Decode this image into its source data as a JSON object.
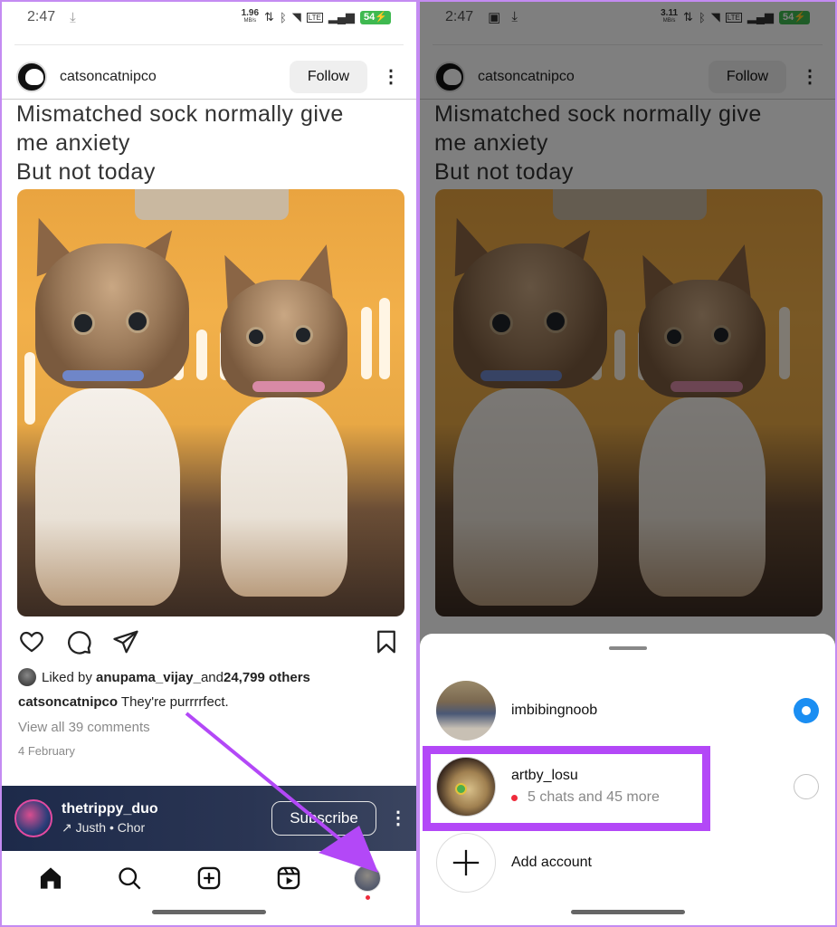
{
  "statusbar_left": {
    "time": "2:47",
    "speed_value": "1.96",
    "speed_unit": "MB/s",
    "battery": "54"
  },
  "statusbar_right": {
    "time": "2:47",
    "speed_value": "3.11",
    "speed_unit": "MB/s",
    "battery": "54"
  },
  "post": {
    "username": "catsoncatnipco",
    "follow_label": "Follow",
    "image_caption_lines": [
      "Mismatched sock normally give",
      "me anxiety",
      "But not today"
    ],
    "liked_by_prefix": "Liked by ",
    "liked_by_user": "anupama_vijay_",
    "liked_by_and": " and ",
    "liked_by_count": "24,799 others",
    "caption_user": "catsoncatnipco",
    "caption_text": " They're purrrrfect.",
    "view_comments": "View all 39 comments",
    "date": "4 February"
  },
  "music_bar": {
    "account": "thetrippy_duo",
    "song": "↗ Justh • Chor",
    "subscribe_label": "Subscribe"
  },
  "navbar": {
    "items": [
      "home",
      "search",
      "create",
      "reels",
      "profile"
    ],
    "profile_notification": true
  },
  "account_switcher": {
    "accounts": [
      {
        "username": "imbibingnoob",
        "subtitle": "",
        "selected": true
      },
      {
        "username": "artby_losu",
        "subtitle": "5 chats and 45 more",
        "selected": false,
        "has_unread": true
      }
    ],
    "add_account_label": "Add account"
  },
  "annotation": {
    "highlight_color": "#b348f7",
    "arrow_color": "#b348f7"
  }
}
